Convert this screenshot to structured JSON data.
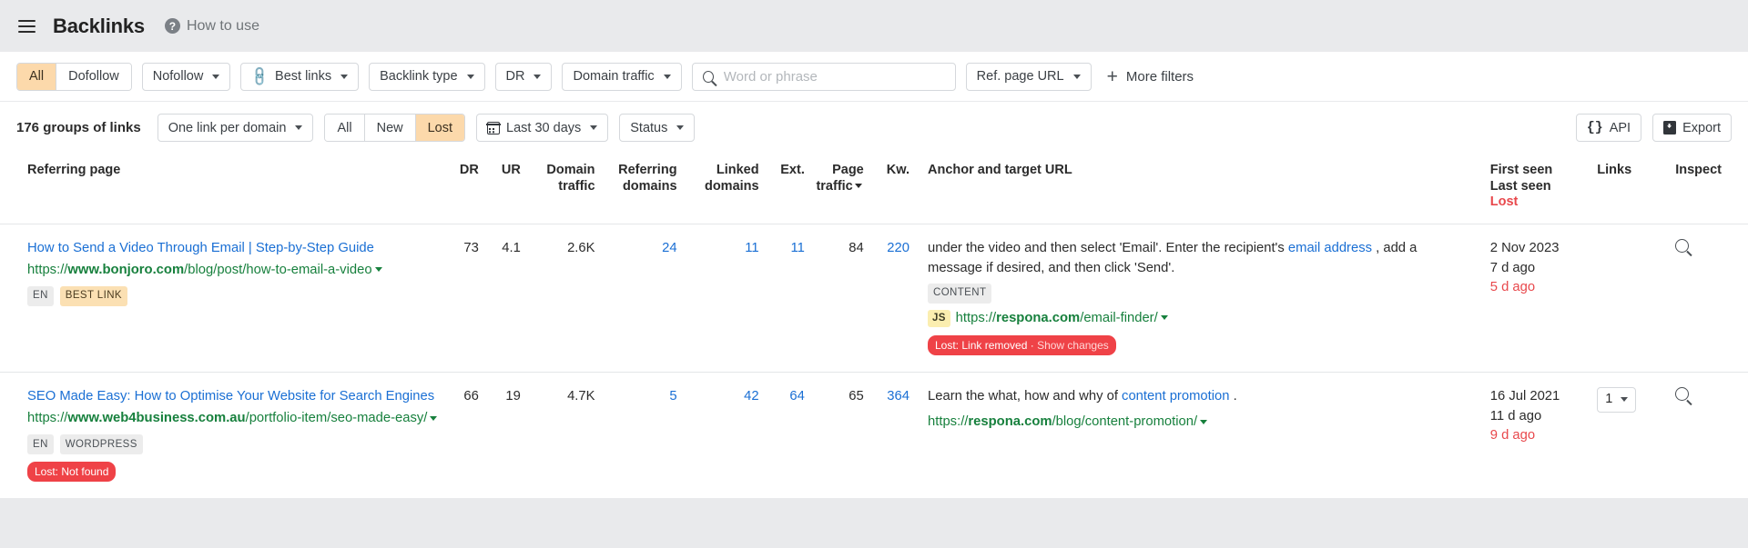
{
  "header": {
    "menu_icon": "hamburger-icon",
    "title": "Backlinks",
    "help_icon": "question-mark-icon",
    "help_label": "How to use"
  },
  "filters": {
    "follow_segments": [
      {
        "label": "All",
        "active": true
      },
      {
        "label": "Dofollow",
        "active": false
      }
    ],
    "nofollow_label": "Nofollow",
    "best_links_label": "Best links",
    "backlink_type_label": "Backlink type",
    "dr_label": "DR",
    "domain_traffic_label": "Domain traffic",
    "search_placeholder": "Word or phrase",
    "search_value": "",
    "ref_page_url_label": "Ref. page URL",
    "more_filters_label": "More filters"
  },
  "results": {
    "groups_count_label": "176 groups of links",
    "group_mode_label": "One link per domain",
    "state_segments": [
      {
        "label": "All",
        "active": false
      },
      {
        "label": "New",
        "active": false
      },
      {
        "label": "Lost",
        "active": true
      }
    ],
    "date_range_label": "Last 30 days",
    "status_label": "Status",
    "api_label": "API",
    "export_label": "Export"
  },
  "table": {
    "headers": {
      "referring_page": "Referring page",
      "dr": "DR",
      "ur": "UR",
      "domain_traffic": "Domain traffic",
      "referring_domains": "Referring domains",
      "linked_domains": "Linked domains",
      "ext": "Ext.",
      "page_traffic": "Page traffic",
      "kw": "Kw.",
      "anchor_target": "Anchor and target URL",
      "first_seen": "First seen",
      "last_seen": "Last seen",
      "lost": "Lost",
      "links": "Links",
      "inspect": "Inspect"
    },
    "rows": [
      {
        "title": "How to Send a Video Through Email | Step-by-Step Guide",
        "url_prefix": "https://",
        "url_domain": "www.bonjoro.com",
        "url_path": "/blog/post/how-to-email-a-video",
        "tags": [
          {
            "label": "EN",
            "style": "plain"
          },
          {
            "label": "BEST LINK",
            "style": "best"
          }
        ],
        "lost_badge": "",
        "dr": "73",
        "ur": "4.1",
        "domain_traffic": "2.6K",
        "referring_domains": "24",
        "linked_domains": "11",
        "ext": "11",
        "page_traffic": "84",
        "kw": "220",
        "anchor_pre": "under the video and then select 'Email'. Enter the recipient's ",
        "anchor_link": "email address",
        "anchor_post": " , add a message if desired, and then click 'Send'.",
        "content_tag": "CONTENT",
        "target_badge": "JS",
        "target_prefix": "https://",
        "target_domain": "respona.com",
        "target_path": "/email-finder/",
        "status_pill": "Lost: Link removed",
        "status_pill_action": "Show changes",
        "first_seen": "2 Nov 2023",
        "last_seen": "7 d ago",
        "lost": "5 d ago",
        "links_count": "",
        "inspect_icon": "magnifier-icon"
      },
      {
        "title": "SEO Made Easy: How to Optimise Your Website for Search Engines",
        "url_prefix": "https://",
        "url_domain": "www.web4business.com.au",
        "url_path": "/portfolio-item/seo-made-easy/",
        "tags": [
          {
            "label": "EN",
            "style": "plain"
          },
          {
            "label": "WORDPRESS",
            "style": "wp"
          }
        ],
        "lost_badge": "Lost: Not found",
        "dr": "66",
        "ur": "19",
        "domain_traffic": "4.7K",
        "referring_domains": "5",
        "linked_domains": "42",
        "ext": "64",
        "page_traffic": "65",
        "kw": "364",
        "anchor_pre": "Learn the what, how and why of ",
        "anchor_link": "content promotion",
        "anchor_post": " .",
        "content_tag": "",
        "target_badge": "",
        "target_prefix": "https://",
        "target_domain": "respona.com",
        "target_path": "/blog/content-promotion/",
        "status_pill": "",
        "status_pill_action": "",
        "first_seen": "16 Jul 2021",
        "last_seen": "11 d ago",
        "lost": "9 d ago",
        "links_count": "1",
        "inspect_icon": "magnifier-icon"
      }
    ]
  },
  "colors": {
    "accent_orange": "#fcd9ab",
    "link_blue": "#1a6fd4",
    "url_green": "#17803d",
    "lost_red": "#e8484c",
    "pill_red": "#ef4247"
  }
}
